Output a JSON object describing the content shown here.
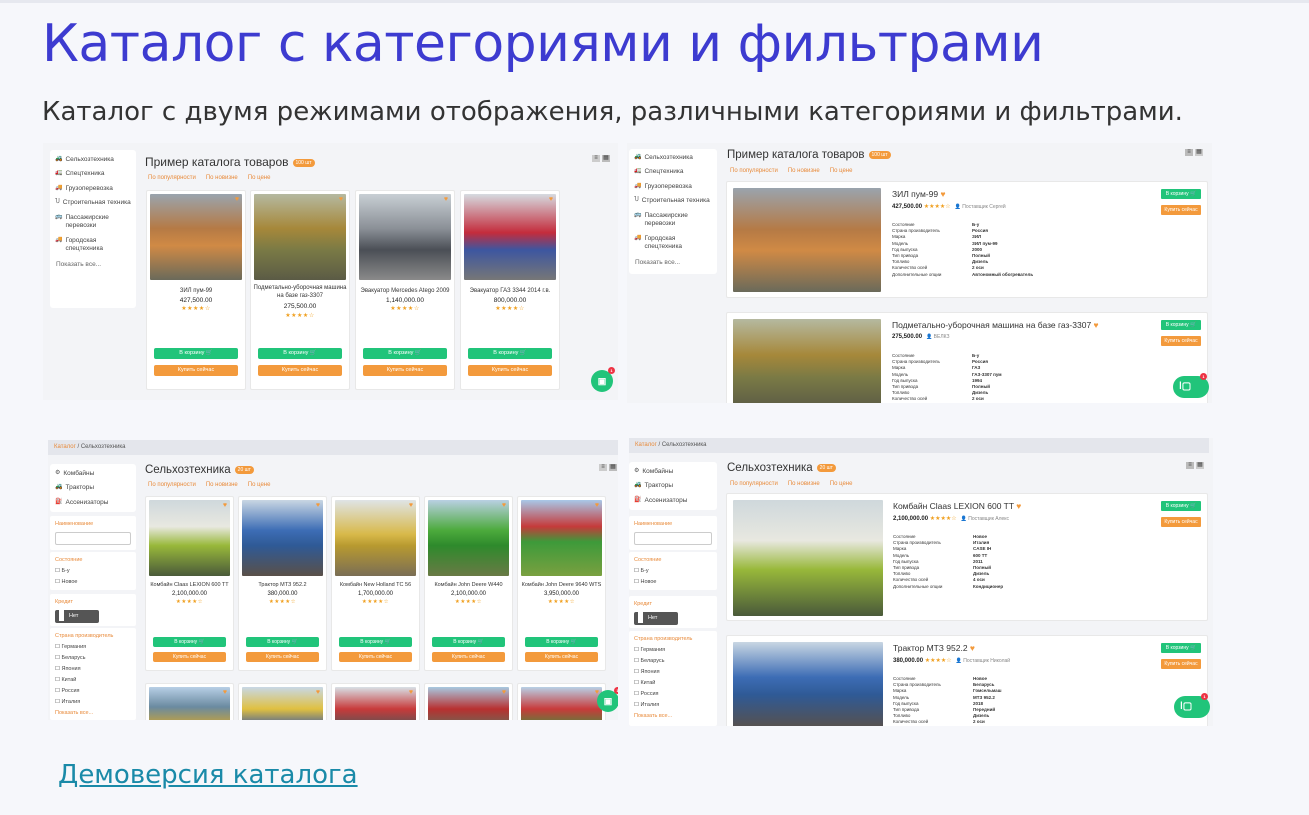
{
  "page": {
    "title": "Каталог с категориями и фильтрами",
    "subtitle": "Каталог с двумя режимами отображения, различными категориями и фильтрами.",
    "demo_link": "Демоверсия каталога"
  },
  "shared": {
    "sort_labels": [
      "По популярности",
      "По новизне",
      "По цене"
    ],
    "cart_button": "В корзину 🛒",
    "buy_button": "Купить сейчас",
    "show_all": "Показать все...",
    "chat_badge": "1",
    "grid_icon": "grid-view-icon",
    "list_icon": "list-view-icon",
    "heart_icon": "heart-icon",
    "cart_icon": "cart-icon"
  },
  "categories": [
    {
      "label": "Сельхозтехника",
      "icon": "tractor-icon"
    },
    {
      "label": "Спецтехника",
      "icon": "truck-icon"
    },
    {
      "label": "Грузоперевозка",
      "icon": "cargo-icon"
    },
    {
      "label": "Строительная техника",
      "icon": "magnet-icon"
    },
    {
      "label": "Пассажирские перевозки",
      "icon": "bus-icon"
    },
    {
      "label": "Городская спецтехника",
      "icon": "city-truck-icon"
    }
  ],
  "subcategories": [
    {
      "label": "Комбайны",
      "icon": "gears-icon"
    },
    {
      "label": "Тракторы",
      "icon": "tractor-icon"
    },
    {
      "label": "Ассенизаторы",
      "icon": "tank-icon"
    }
  ],
  "panel1": {
    "title": "Пример каталога товаров",
    "badge": "100 шт",
    "products": [
      {
        "name": "ЗИЛ пум-99",
        "price": "427,500.00",
        "stars": "★★★★☆"
      },
      {
        "name": "Подметально-уборочная машина на базе газ-3307",
        "price": "275,500.00",
        "stars": "★★★★☆"
      },
      {
        "name": "Эвакуатор Mercedes Atego 2009",
        "price": "1,140,000.00",
        "stars": "★★★★☆"
      },
      {
        "name": "Эвакуатор ГАЗ 3344 2014 г.в.",
        "price": "800,000.00",
        "stars": "★★★★☆"
      }
    ]
  },
  "panel2": {
    "title": "Пример каталога товаров",
    "badge": "100 шт",
    "items": [
      {
        "name": "ЗИЛ пум-99",
        "price": "427,500.00",
        "stars": "★★★★☆",
        "seller": "👤 Поставщик Сергей",
        "specs": [
          [
            "Состояние",
            "Б-у"
          ],
          [
            "Страна производитель",
            "Россия"
          ],
          [
            "Марка",
            "ЗИЛ"
          ],
          [
            "Модель",
            "ЗИЛ пум-99"
          ],
          [
            "Год выпуска",
            "2000"
          ],
          [
            "Тип привода",
            "Полный"
          ],
          [
            "Топливо",
            "Дизель"
          ],
          [
            "Количество осей",
            "2 оси"
          ],
          [
            "Дополнительные опции",
            "Автономный обогреватель"
          ]
        ]
      },
      {
        "name": "Подметально-уборочная машина на базе газ-3307",
        "price": "275,500.00",
        "stars": "",
        "seller": "👤 ВЕЛКЗ",
        "specs": [
          [
            "Состояние",
            "Б-у"
          ],
          [
            "Страна производитель",
            "Россия"
          ],
          [
            "Марка",
            "ГАЗ"
          ],
          [
            "Модель",
            "ГАЗ-3307 пум"
          ],
          [
            "Год выпуска",
            "1994"
          ],
          [
            "Тип привода",
            "Полный"
          ],
          [
            "Топливо",
            "Дизель"
          ],
          [
            "Количество осей",
            "2 оси"
          ]
        ]
      }
    ]
  },
  "panel3": {
    "breadcrumb_root": "Каталог",
    "breadcrumb_current": "Сельхозтехника",
    "title": "Сельхозтехника",
    "badge": "20 шт",
    "filters": {
      "name_label": "Наименование",
      "state_label": "Состояние",
      "state_options": [
        "Б-у",
        "Новое"
      ],
      "credit_label": "Кредит",
      "credit_value": "Нет",
      "country_label": "Страна производитель",
      "country_options": [
        "Германия",
        "Беларусь",
        "Япония",
        "Китай",
        "Россия",
        "Италия"
      ],
      "show_all": "Показать все..."
    },
    "products": [
      {
        "name": "Комбайн Claas LEXION 600 TT",
        "price": "2,100,000.00",
        "stars": "★★★★☆"
      },
      {
        "name": "Трактор МТЗ 952.2",
        "price": "380,000.00",
        "stars": "★★★★☆"
      },
      {
        "name": "Комбайн New Holland TC 56",
        "price": "1,700,000.00",
        "stars": "★★★★☆"
      },
      {
        "name": "Комбайн John Deere W440",
        "price": "2,100,000.00",
        "stars": "★★★★☆"
      },
      {
        "name": "Комбайн John Deere 9640 WTS",
        "price": "3,950,000.00",
        "stars": "★★★★☆"
      }
    ]
  },
  "panel4": {
    "breadcrumb_root": "Каталог",
    "breadcrumb_current": "Сельхозтехника",
    "title": "Сельхозтехника",
    "badge": "20 шт",
    "items": [
      {
        "name": "Комбайн Claas LEXION 600 TT",
        "price": "2,100,000.00",
        "stars": "★★★★☆",
        "seller": "👤 Поставщик Алекс",
        "specs": [
          [
            "Состояние",
            "Новое"
          ],
          [
            "Страна производитель",
            "Италия"
          ],
          [
            "Марка",
            "CASE IH"
          ],
          [
            "Модель",
            "600 TT"
          ],
          [
            "Год выпуска",
            "2011"
          ],
          [
            "Тип привода",
            "Полный"
          ],
          [
            "Топливо",
            "Дизель"
          ],
          [
            "Количество осей",
            "4 оси"
          ],
          [
            "Дополнительные опции",
            "Кондиционер"
          ]
        ]
      },
      {
        "name": "Трактор МТЗ 952.2",
        "price": "380,000.00",
        "stars": "★★★★☆",
        "seller": "👤 Поставщик Николай",
        "specs": [
          [
            "Состояние",
            "Новое"
          ],
          [
            "Страна производитель",
            "Беларусь"
          ],
          [
            "Марка",
            "Гомсельмаш"
          ],
          [
            "Модель",
            "МТЗ 952.2"
          ],
          [
            "Год выпуска",
            "2018"
          ],
          [
            "Тип привода",
            "Передний"
          ],
          [
            "Топливо",
            "Дизель"
          ],
          [
            "Количество осей",
            "2 оси"
          ]
        ]
      }
    ]
  }
}
